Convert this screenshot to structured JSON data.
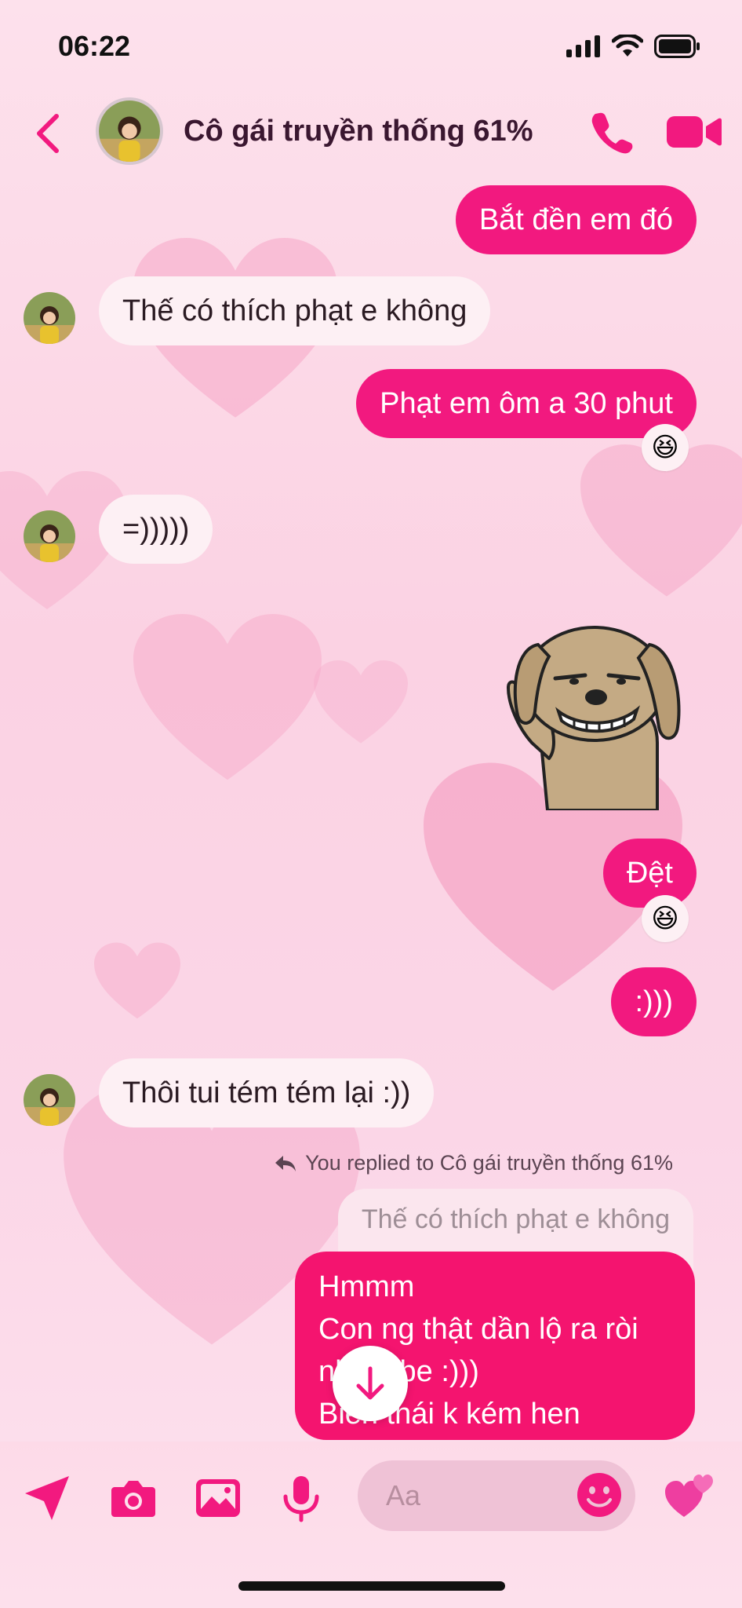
{
  "status_bar": {
    "time": "06:22"
  },
  "header": {
    "contact_name": "Cô gái truyền thống 61%"
  },
  "messages": [
    {
      "from": "me",
      "text": "Bắt đền em đó"
    },
    {
      "from": "them",
      "text": "Thế có thích phạt e không"
    },
    {
      "from": "me",
      "text": "Phạt em ôm a 30 phut",
      "reaction": "😆"
    },
    {
      "from": "them",
      "text": "=)))))"
    },
    {
      "from": "me",
      "text": "Đệt",
      "reaction": "😆"
    },
    {
      "from": "me",
      "text": ":)))"
    },
    {
      "from": "them",
      "text": "Thôi tui tém tém lại :))"
    }
  ],
  "sticker": {
    "name": "sticker-dog-salute"
  },
  "reply": {
    "meta": "You replied to Cô gái truyền thống 61%",
    "quoted": "Thế có thích phạt e không",
    "lines": [
      "Hmmm",
      "Con ng thật dần lộ ra ròi",
      "nhỉ babe :)))",
      "Biến thái k kém hen"
    ]
  },
  "composer": {
    "placeholder": "Aa"
  },
  "colors": {
    "accent": "#f2197f",
    "header_title": "#3a1730"
  }
}
